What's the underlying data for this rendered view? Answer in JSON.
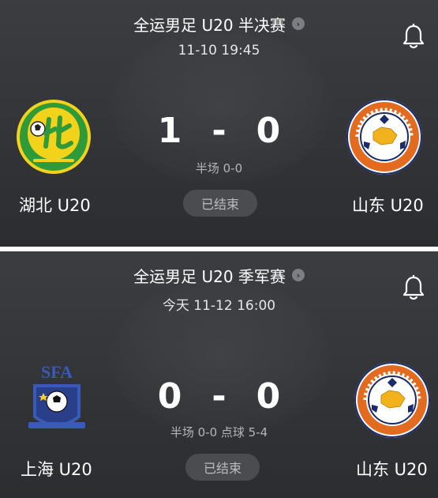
{
  "matches": [
    {
      "competition": "全运男足 U20 半决赛",
      "datetime": "11-10 19:45",
      "home": {
        "name": "湖北 U20"
      },
      "away": {
        "name": "山东 U20"
      },
      "home_score": "1",
      "away_score": "0",
      "dash": "-",
      "half_time": "半场 0-0",
      "status": "已结束"
    },
    {
      "competition": "全运男足 U20 季军赛",
      "datetime": "今天 11-12 16:00",
      "home": {
        "name": "上海 U20",
        "logo_text": "SFA"
      },
      "away": {
        "name": "山东 U20"
      },
      "home_score": "0",
      "away_score": "0",
      "dash": "-",
      "half_time": "半场 0-0 点球 5-4",
      "status": "已结束"
    }
  ],
  "icons": {
    "bell": "bell-icon",
    "arrow": "chevron-right-icon"
  },
  "colors": {
    "card_bg": "#2f3134",
    "badge_bg": "#4a4c50",
    "hubei_green": "#2e9a3a",
    "hubei_yellow": "#f2d21b",
    "shandong_orange": "#e36b1f",
    "shandong_navy": "#1b2a6b",
    "shanghai_blue": "#3a5ab8"
  }
}
